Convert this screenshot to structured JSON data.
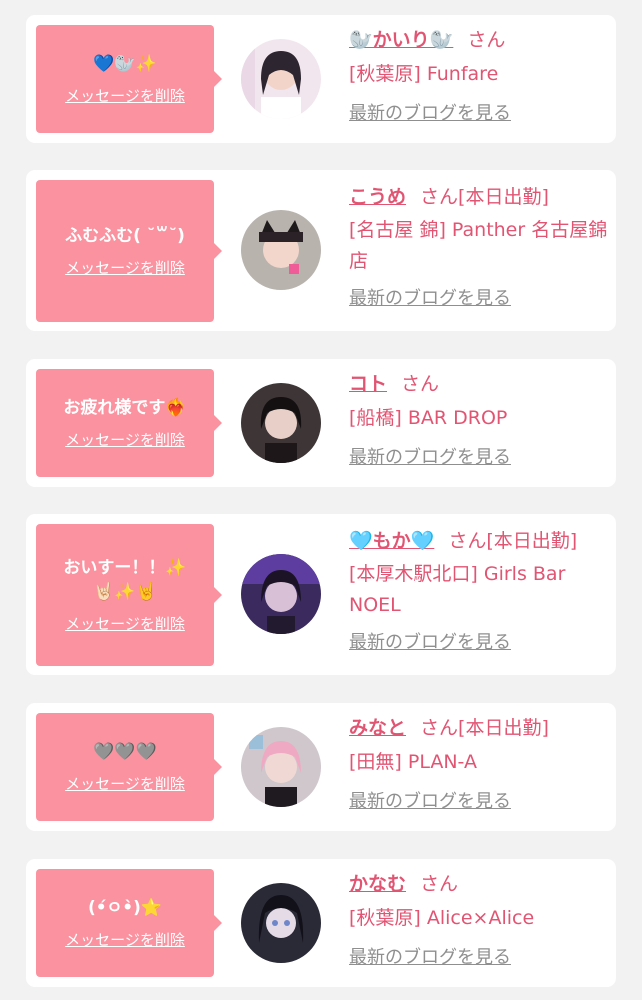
{
  "entries": [
    {
      "message": "💙🦭✨",
      "delete_label": "メッセージを削除",
      "name": "🦭かいり🦭",
      "san": "さん",
      "status": "",
      "shop": "[秋葉原] Funfare",
      "blog_label": "最新のブログを見る"
    },
    {
      "message": "ふむふむ( ˘꒳˘)",
      "delete_label": "メッセージを削除",
      "name": "こうめ",
      "san": "さん",
      "status": "[本日出勤]",
      "shop": "[名古屋 錦] Panther 名古屋錦店",
      "blog_label": "最新のブログを見る"
    },
    {
      "message": "お疲れ様です❤️‍🔥",
      "delete_label": "メッセージを削除",
      "name": "コト",
      "san": "さん",
      "status": "",
      "shop": "[船橋] BAR DROP",
      "blog_label": "最新のブログを見る"
    },
    {
      "message": "おいすー！！✨\n🤘🏻✨🤘",
      "delete_label": "メッセージを削除",
      "name": "🩵もか🩵",
      "san": "さん",
      "status": "[本日出勤]",
      "shop": "[本厚木駅北口] Girls Bar NOEL",
      "blog_label": "最新のブログを見る"
    },
    {
      "message": "🩶🩶🩶",
      "delete_label": "メッセージを削除",
      "name": "みなと",
      "san": "さん",
      "status": "[本日出勤]",
      "shop": "[田無] PLAN-A",
      "blog_label": "最新のブログを見る"
    },
    {
      "message": "(•́ㅇ•̀)⭐",
      "delete_label": "メッセージを削除",
      "name": "かなむ",
      "san": "さん",
      "status": "",
      "shop": "[秋葉原] Alice×Alice",
      "blog_label": "最新のブログを見る"
    }
  ],
  "colors": {
    "background": "#f2f2f2",
    "card": "#ffffff",
    "bubble": "#fb929f",
    "accent_text": "#e15573",
    "blog_link": "#8f8f8f"
  }
}
